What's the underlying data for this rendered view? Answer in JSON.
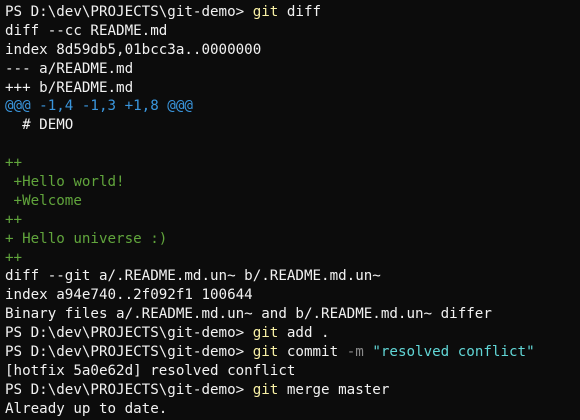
{
  "colors": {
    "background": "#0c0c0c",
    "default": "#f2f2f2",
    "yellow": "#f9f1a5",
    "gray": "#8a8a8a",
    "light_blue": "#61d6d6",
    "teal": "#3a96dd",
    "green": "#13a10e",
    "green_dark": "#61a53c"
  },
  "terminal": {
    "lines": [
      {
        "segments": [
          {
            "text": "PS D:\\dev\\PROJECTS\\git-demo> ",
            "color": "default"
          },
          {
            "text": "git",
            "color": "yellow"
          },
          {
            "text": " diff",
            "color": "default"
          }
        ]
      },
      {
        "segments": [
          {
            "text": "diff --cc README.md",
            "color": "default"
          }
        ]
      },
      {
        "segments": [
          {
            "text": "index 8d59db5,01bcc3a..0000000",
            "color": "default"
          }
        ]
      },
      {
        "segments": [
          {
            "text": "--- a/README.md",
            "color": "default"
          }
        ]
      },
      {
        "segments": [
          {
            "text": "+++ b/README.md",
            "color": "default"
          }
        ]
      },
      {
        "segments": [
          {
            "text": "@@@ -1,4 -1,3 +1,8 @@@",
            "color": "teal"
          }
        ]
      },
      {
        "segments": [
          {
            "text": "  # DEMO",
            "color": "default"
          }
        ]
      },
      {
        "segments": [
          {
            "text": "",
            "color": "default"
          }
        ]
      },
      {
        "segments": [
          {
            "text": "++",
            "color": "green_dark"
          }
        ]
      },
      {
        "segments": [
          {
            "text": " +Hello world!",
            "color": "green_dark"
          }
        ]
      },
      {
        "segments": [
          {
            "text": " +Welcome",
            "color": "green_dark"
          }
        ]
      },
      {
        "segments": [
          {
            "text": "++",
            "color": "green_dark"
          }
        ]
      },
      {
        "segments": [
          {
            "text": "+ Hello universe :)",
            "color": "green_dark"
          }
        ]
      },
      {
        "segments": [
          {
            "text": "++",
            "color": "green_dark"
          }
        ]
      },
      {
        "segments": [
          {
            "text": "diff --git a/.README.md.un~ b/.README.md.un~",
            "color": "default"
          }
        ]
      },
      {
        "segments": [
          {
            "text": "index a94e740..2f092f1 100644",
            "color": "default"
          }
        ]
      },
      {
        "segments": [
          {
            "text": "Binary files a/.README.md.un~ and b/.README.md.un~ differ",
            "color": "default"
          }
        ]
      },
      {
        "segments": [
          {
            "text": "PS D:\\dev\\PROJECTS\\git-demo> ",
            "color": "default"
          },
          {
            "text": "git",
            "color": "yellow"
          },
          {
            "text": " add .",
            "color": "default"
          }
        ]
      },
      {
        "segments": [
          {
            "text": "PS D:\\dev\\PROJECTS\\git-demo> ",
            "color": "default"
          },
          {
            "text": "git",
            "color": "yellow"
          },
          {
            "text": " commit ",
            "color": "default"
          },
          {
            "text": "-m",
            "color": "gray"
          },
          {
            "text": " ",
            "color": "default"
          },
          {
            "text": "\"resolved conflict\"",
            "color": "light_blue"
          }
        ]
      },
      {
        "segments": [
          {
            "text": "[hotfix 5a0e62d] resolved conflict",
            "color": "default"
          }
        ]
      },
      {
        "segments": [
          {
            "text": "PS D:\\dev\\PROJECTS\\git-demo> ",
            "color": "default"
          },
          {
            "text": "git",
            "color": "yellow"
          },
          {
            "text": " merge master",
            "color": "default"
          }
        ]
      },
      {
        "segments": [
          {
            "text": "Already up to date.",
            "color": "default"
          }
        ]
      }
    ]
  }
}
